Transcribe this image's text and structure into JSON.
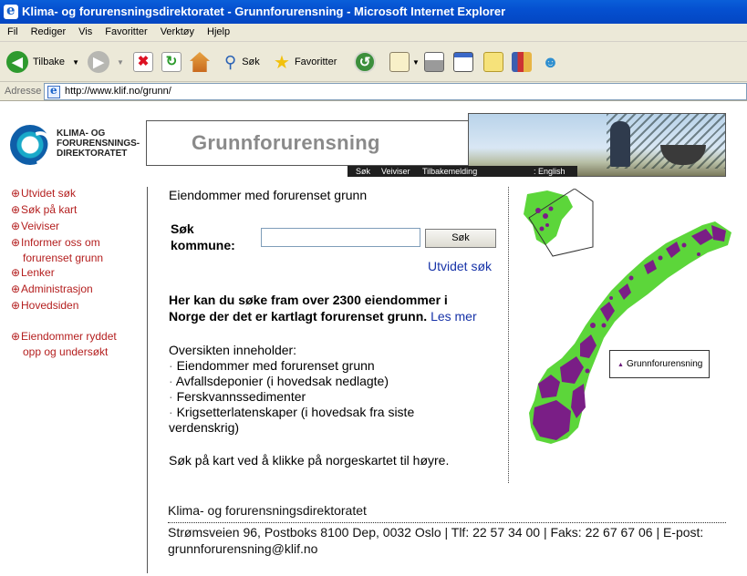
{
  "window": {
    "title": "Klima- og forurensningsdirektoratet - Grunnforurensning - Microsoft Internet Explorer"
  },
  "menu": [
    "Fil",
    "Rediger",
    "Vis",
    "Favoritter",
    "Verktøy",
    "Hjelp"
  ],
  "toolbar": {
    "back_label": "Tilbake",
    "search_label": "Søk",
    "favorites_label": "Favoritter"
  },
  "address": {
    "label": "Adresse",
    "url": "http://www.klif.no/grunn/"
  },
  "header": {
    "logo_lines": [
      "KLIMA- OG",
      "FORURENSNINGS-",
      "DIREKTORATET"
    ],
    "title": "Grunnforurensning",
    "subnav": [
      "Søk",
      "Veiviser",
      "Tilbakemelding",
      ": English"
    ]
  },
  "leftnav": {
    "items": [
      "Utvidet søk",
      "Søk på kart",
      "Veiviser",
      "Informer oss om",
      "forurenset grunn",
      "Lenker",
      "Administrasjon",
      "Hovedsiden",
      "Eiendommer ryddet",
      "opp og undersøkt"
    ],
    "bullet": "⊕"
  },
  "main": {
    "heading": "Eiendommer med forurenset grunn",
    "search_label_1": "Søk",
    "search_label_2": "kommune:",
    "search_value": "",
    "search_button": "Søk",
    "advanced_link": "Utvidet søk",
    "intro_1": "Her kan du søke fram over 2300 eiendommer i",
    "intro_2": "Norge der det er kartlagt forurenset grunn.",
    "read_more": "Les mer",
    "overview_title": "Oversikten inneholder:",
    "overview_items": [
      "Eiendommer med forurenset grunn",
      "Avfallsdeponier (i hovedsak nedlagte)",
      "Ferskvannssedimenter",
      "Krigsetterlatenskaper (i hovedsak fra siste"
    ],
    "overview_cont": "verdenskrig)",
    "map_hint": "Søk på kart ved å klikke på norgeskartet til høyre."
  },
  "map": {
    "legend": "Grunnforurensning",
    "colors": {
      "land": "#5cd63a",
      "sites": "#7a1e86"
    }
  },
  "footer": {
    "org": "Klima- og forurensningsdirektoratet",
    "address": "Strømsveien 96, Postboks 8100 Dep, 0032 Oslo | Tlf: 22 57 34 00 | Faks: 22 67 67 06 | E-post:",
    "email": "grunnforurensning@klif.no"
  }
}
